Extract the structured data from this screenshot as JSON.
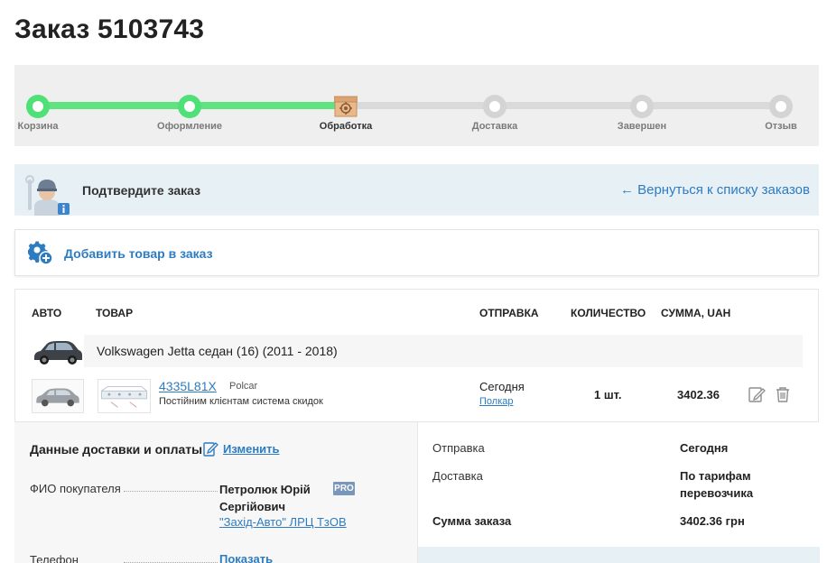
{
  "page": {
    "title": "Заказ 5103743"
  },
  "progress": {
    "steps": [
      {
        "label": "Корзина",
        "state": "done"
      },
      {
        "label": "Оформление",
        "state": "done"
      },
      {
        "label": "Обработка",
        "state": "current"
      },
      {
        "label": "Доставка",
        "state": "todo"
      },
      {
        "label": "Завершен",
        "state": "todo"
      },
      {
        "label": "Отзыв",
        "state": "todo"
      }
    ],
    "colors": {
      "done": "#4fe077",
      "todo": "#d4d4d4"
    }
  },
  "confirm": {
    "message": "Подтвердите заказ",
    "back_link": "← Вернуться к списку заказов"
  },
  "add_product": {
    "label": "Добавить товар в заказ"
  },
  "table": {
    "headers": {
      "auto": "АВТО",
      "product": "ТОВАР",
      "shipping": "ОТПРАВКА",
      "quantity": "КОЛИЧЕСТВО",
      "sum": "СУММА, UAH"
    },
    "car": {
      "name": "Volkswagen Jetta седан (16) (2011 - 2018)"
    },
    "item": {
      "code": "4335L81X",
      "brand": "Polcar",
      "description": "Постійним клієнтам система скидок",
      "ship_when": "Сегодня",
      "ship_supplier": "Полкар",
      "quantity": "1 шт.",
      "sum": "3402.36"
    }
  },
  "delivery": {
    "title": "Данные доставки и оплаты",
    "edit_link": "Изменить",
    "buyer_label": "ФИО покупателя",
    "buyer_name": "Петролюк Юрій Сергійович",
    "buyer_badge": "PRO",
    "buyer_company": "\"Захід-Авто\" ЛРЦ ТзОВ",
    "phone_label": "Телефон",
    "phone_link": "Показать"
  },
  "summary": {
    "shipping_label": "Отправка",
    "shipping_value": "Сегодня",
    "delivery_label": "Доставка",
    "delivery_value": "По тарифам перевозчика",
    "total_label": "Сумма заказа",
    "total_value": "3402.36 грн"
  },
  "colors": {
    "accent": "#2d7cc2",
    "success": "#4fe077",
    "info_bg": "#e7f0f5"
  }
}
